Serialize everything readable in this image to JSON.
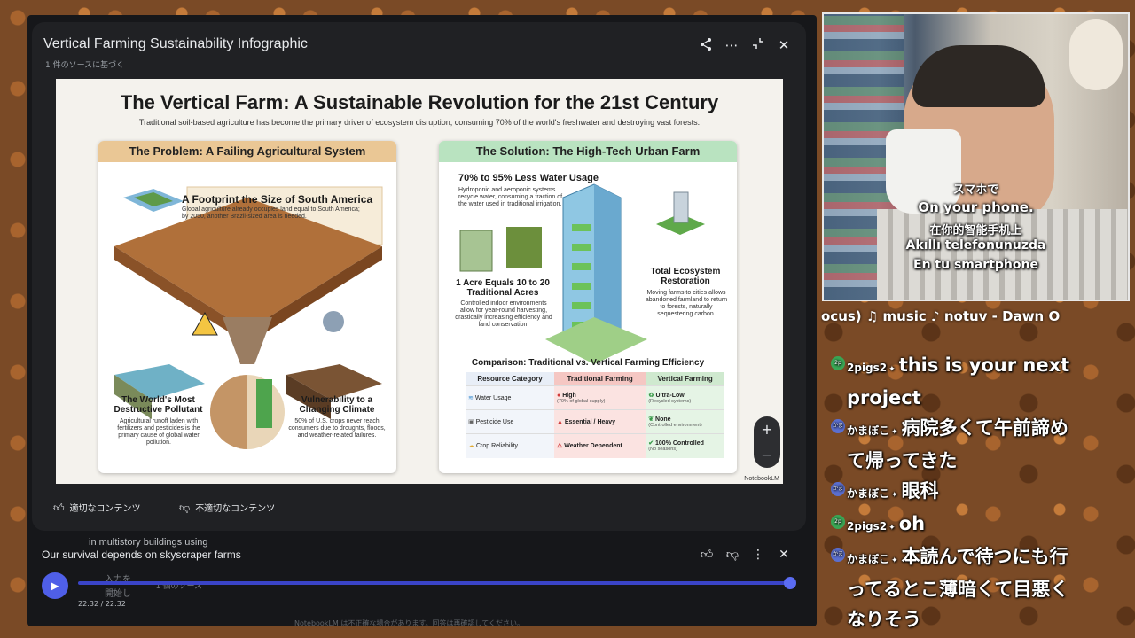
{
  "modal": {
    "title": "Vertical Farming Sustainability Infographic",
    "subtitle": "1 件のソースに基づく",
    "icons": [
      "share-icon",
      "more-icon",
      "collapse-icon",
      "close-icon"
    ]
  },
  "infographic": {
    "title": "The Vertical Farm: A Sustainable Revolution for the 21st Century",
    "subtitle": "Traditional soil-based agriculture has become the primary driver of ecosystem disruption, consuming 70% of the world's freshwater and destroying vast forests.",
    "problem": {
      "header": "The Problem: A Failing Agricultural System",
      "footprint_title": "A Footprint the Size of South America",
      "footprint_text": "Global agriculture already occupies land equal to South America; by 2050, another Brazil-sized area is needed.",
      "pollutant_title": "The World's Most Destructive Pollutant",
      "pollutant_text": "Agricultural runoff laden with fertilizers and pesticides is the primary cause of global water pollution.",
      "climate_title": "Vulnerability to a Changing Climate",
      "climate_text": "50% of U.S. crops never reach consumers due to droughts, floods, and weather-related failures."
    },
    "solution": {
      "header": "The Solution: The High-Tech Urban Farm",
      "water_title": "70% to 95% Less Water Usage",
      "water_text": "Hydroponic and aeroponic systems recycle water, consuming a fraction of the water used in traditional irrigation.",
      "acre_title": "1 Acre Equals 10 to 20 Traditional Acres",
      "acre_text": "Controlled indoor environments allow for year-round harvesting, drastically increasing efficiency and land conservation.",
      "restore_title": "Total Ecosystem Restoration",
      "restore_text": "Moving farms to cities allows abandoned farmland to return to forests, naturally sequestering carbon.",
      "comparison_title": "Comparison: Traditional vs. Vertical Farming Efficiency",
      "columns": [
        "Resource Category",
        "Traditional Farming",
        "Vertical Farming"
      ],
      "rows": [
        {
          "category": "Water Usage",
          "trad": "High",
          "trad_note": "(70% of global supply)",
          "vert": "Ultra-Low",
          "vert_note": "(Recycled systems)"
        },
        {
          "category": "Pesticide Use",
          "trad": "Essential / Heavy",
          "trad_note": "",
          "vert": "None",
          "vert_note": "(Controlled environment)"
        },
        {
          "category": "Crop Reliability",
          "trad": "Weather Dependent",
          "trad_note": "",
          "vert": "100% Controlled",
          "vert_note": "(No seasons)"
        }
      ]
    },
    "brand": "NotebookLM"
  },
  "zoom": {
    "in": "+",
    "out": "−"
  },
  "feedback": {
    "good": "適切なコンテンツ",
    "bad": "不適切なコンテンツ"
  },
  "background": {
    "line1": "in multistory buildings using",
    "line2": "入力を",
    "line3": "開始し",
    "line4": "1 個のソース"
  },
  "player": {
    "title": "Our survival depends on skyscraper farms",
    "time": "22:32 / 22:32",
    "progress": 1.0
  },
  "disclaimer": "NotebookLM は不正確な場合があります。回答は再確認してください。",
  "captions": [
    "スマホで",
    "On your phone.",
    "在你的智能手机上",
    "Akıllı telefonunuzda",
    "En tu smartphone"
  ],
  "now_playing": "ocus)   ♫ music ♪ notuv - Dawn O",
  "chat": [
    {
      "user": "2pigs2",
      "avatar": "2p",
      "color": "#3aa655",
      "text": "this is your next project"
    },
    {
      "user": "かまぼこ",
      "avatar": "かま",
      "color": "#5b6fcf",
      "text": "病院多くて午前諦めて帰ってきた"
    },
    {
      "user": "かまぼこ",
      "avatar": "かま",
      "color": "#5b6fcf",
      "text": "眼科"
    },
    {
      "user": "2pigs2",
      "avatar": "2p",
      "color": "#3aa655",
      "text": "oh"
    },
    {
      "user": "かまぼこ",
      "avatar": "かま",
      "color": "#5b6fcf",
      "text": "本読んで待つにも行ってるとこ薄暗くて目悪くなりそう"
    }
  ]
}
